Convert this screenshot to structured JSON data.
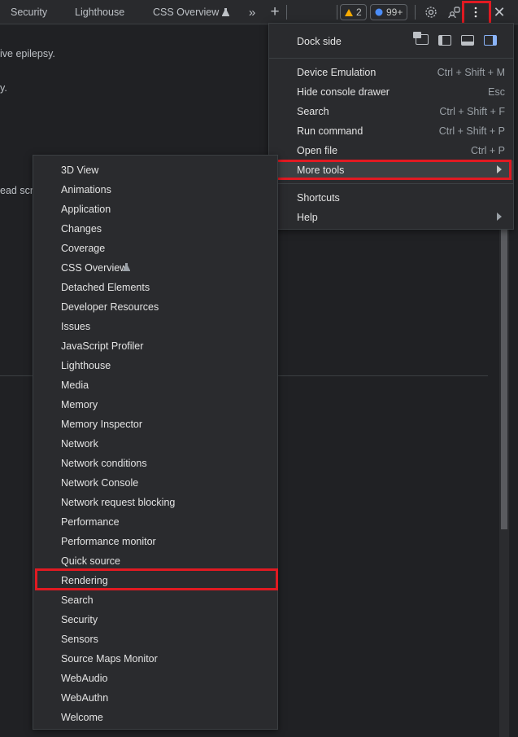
{
  "tabs": [
    {
      "label": "Security"
    },
    {
      "label": "Lighthouse"
    },
    {
      "label": "CSS Overview",
      "experimental": true
    }
  ],
  "toolbar": {
    "more_tabs_icon": "chevron-double-right-icon",
    "new_tab_icon": "plus-icon",
    "warnings_count": "2",
    "issues_count": "99+",
    "settings_icon": "gear-icon",
    "remote_icon": "people-icon",
    "menu_icon": "vertical-ellipsis-icon",
    "close_icon": "close-icon"
  },
  "background": {
    "line1": "ive epilepsy.",
    "line2": "y.",
    "line3": "ead scro"
  },
  "main_menu": {
    "dock_side_label": "Dock side",
    "items": [
      {
        "label": "Device Emulation",
        "shortcut": "Ctrl + Shift + M"
      },
      {
        "label": "Hide console drawer",
        "shortcut": "Esc"
      },
      {
        "label": "Search",
        "shortcut": "Ctrl + Shift + F"
      },
      {
        "label": "Run command",
        "shortcut": "Ctrl + Shift + P"
      },
      {
        "label": "Open file",
        "shortcut": "Ctrl + P"
      },
      {
        "label": "More tools",
        "shortcut": ""
      }
    ],
    "items2": [
      {
        "label": "Shortcuts"
      },
      {
        "label": "Help"
      }
    ]
  },
  "more_tools": [
    "3D View",
    "Animations",
    "Application",
    "Changes",
    "Coverage",
    "CSS Overview",
    "Detached Elements",
    "Developer Resources",
    "Issues",
    "JavaScript Profiler",
    "Lighthouse",
    "Media",
    "Memory",
    "Memory Inspector",
    "Network",
    "Network conditions",
    "Network Console",
    "Network request blocking",
    "Performance",
    "Performance monitor",
    "Quick source",
    "Rendering",
    "Search",
    "Security",
    "Sensors",
    "Source Maps Monitor",
    "WebAudio",
    "WebAuthn",
    "Welcome"
  ],
  "colors": {
    "highlight": "#e01a22",
    "warning": "#f9ab00",
    "info": "#4b8df8",
    "dock_active": "#8ab4f8"
  }
}
